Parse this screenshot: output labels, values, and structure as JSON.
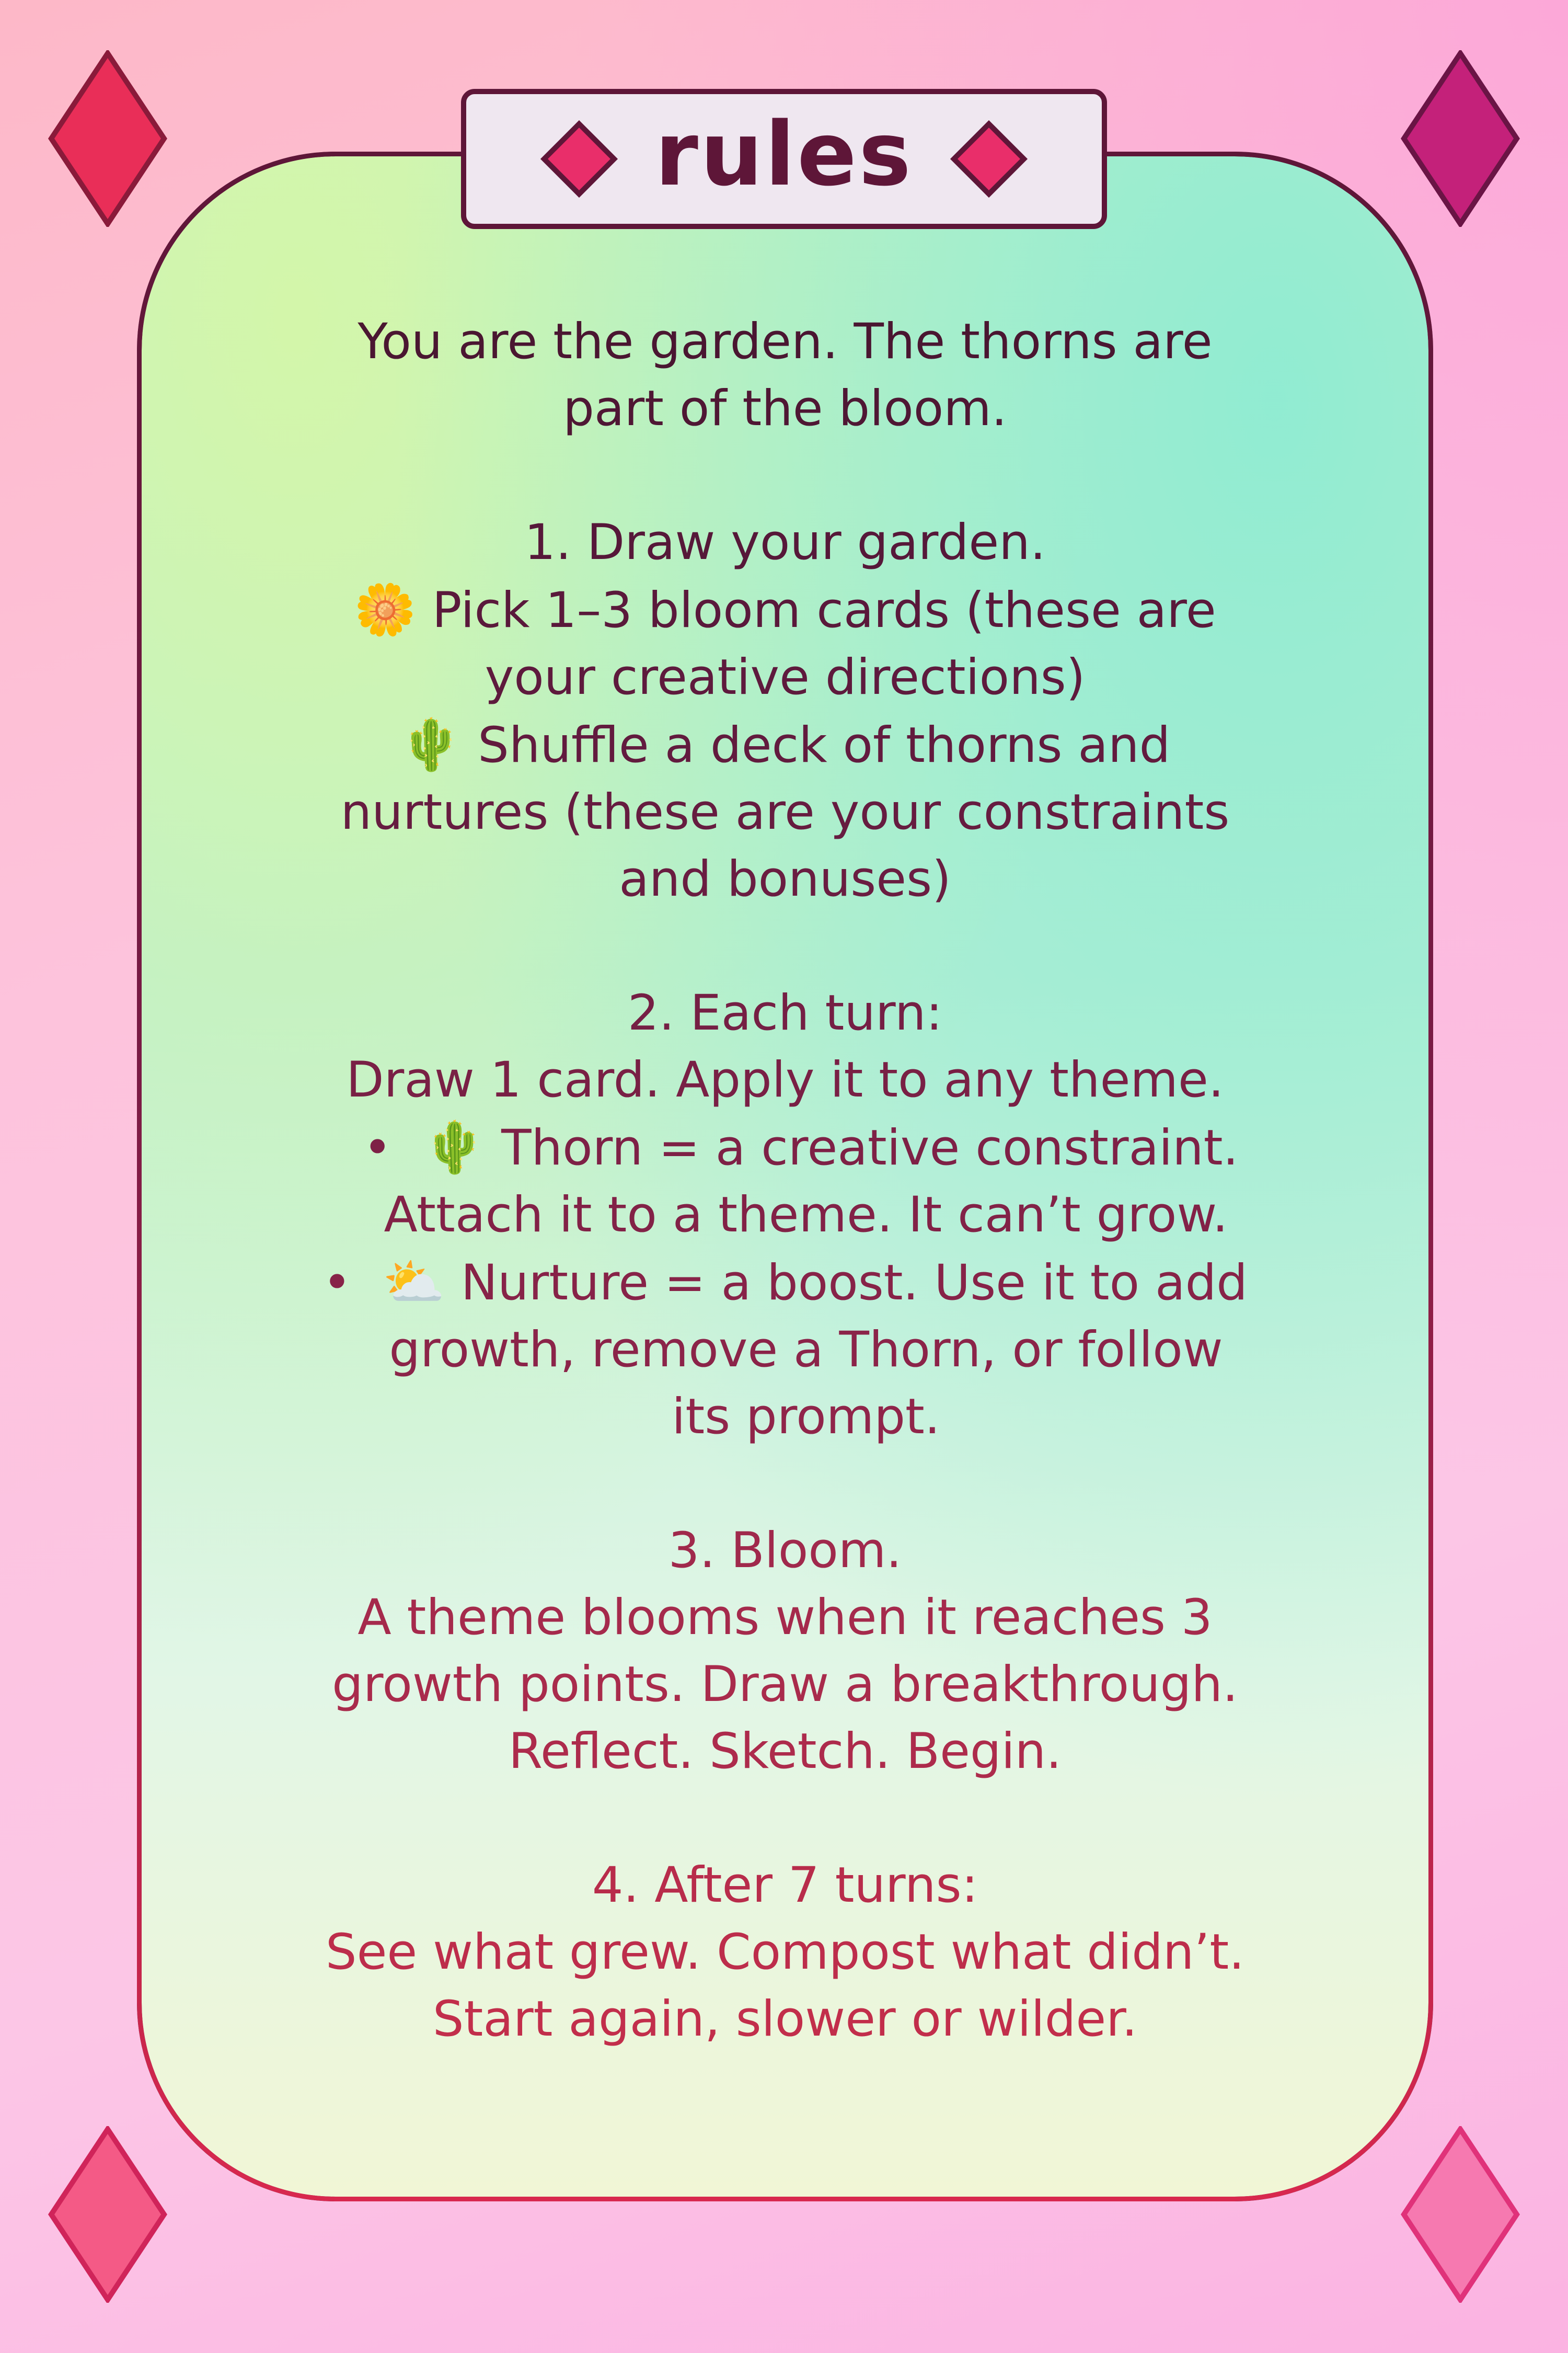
{
  "title": "rules",
  "intro": [
    "You are the garden. The thorns are",
    "part of the bloom."
  ],
  "step1": {
    "heading": "1. Draw your garden.",
    "pick_emoji": "🌼",
    "pick_lines": [
      "Pick 1–3 bloom cards (these are",
      "your creative directions)"
    ],
    "shuffle_emoji": "🌵",
    "shuffle_lines": [
      "Shuffle a deck of thorns and",
      "nurtures (these are your constraints",
      "and bonuses)"
    ]
  },
  "step2": {
    "heading": "2. Each turn:",
    "line": "Draw 1 card. Apply it to any theme.",
    "thorn_emoji": "🌵",
    "thorn_lines": [
      "Thorn = a creative constraint.",
      "Attach it to a theme. It can’t grow."
    ],
    "nurture_emoji": "⛅",
    "nurture_lines": [
      "Nurture = a boost. Use it to add",
      "growth, remove a Thorn, or follow",
      "its prompt."
    ],
    "bullet_char": "•"
  },
  "step3": {
    "heading": "3. Bloom.",
    "lines": [
      "A theme blooms when it reaches 3",
      "growth points. Draw a breakthrough.",
      "Reflect. Sketch. Begin."
    ]
  },
  "step4": {
    "heading": "4. After 7 turns:",
    "lines": [
      "See what grew. Compost what didn’t.",
      "Start again, slower or wilder."
    ]
  },
  "colors": {
    "line1": "#4a1631",
    "line2": "#52183a",
    "line3": "#5c1b3e",
    "line4": "#661d41",
    "line5": "#6f1f44",
    "line6": "#7b2146",
    "line7": "#882449",
    "line8": "#94274b",
    "line9": "#a0294c",
    "line10": "#ad2b4c",
    "line11": "#b82c4b",
    "line12": "#c12d4b",
    "diamond_left": "#e8245a",
    "diamond_right": "#c9247a"
  },
  "icons": [
    "diamond-icon",
    "daisy-icon",
    "cactus-icon",
    "sun-behind-cloud-icon"
  ]
}
